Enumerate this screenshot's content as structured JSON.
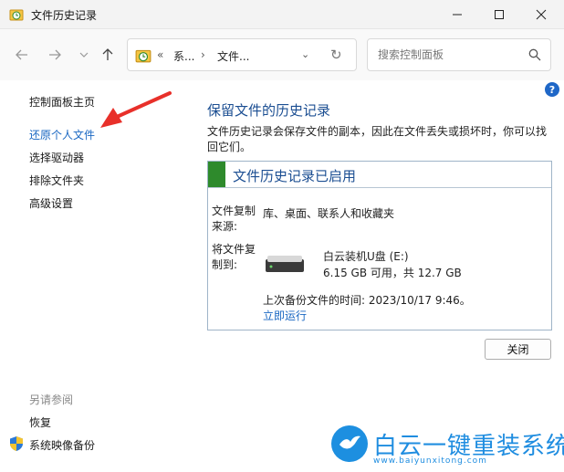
{
  "window": {
    "title": "文件历史记录"
  },
  "address": {
    "crumb1": "系...",
    "crumb2": "文件...",
    "prefix": "«"
  },
  "search": {
    "placeholder": "搜索控制面板"
  },
  "sidebar": {
    "items": [
      {
        "label": "控制面板主页"
      },
      {
        "label": "还原个人文件"
      },
      {
        "label": "选择驱动器"
      },
      {
        "label": "排除文件夹"
      },
      {
        "label": "高级设置"
      }
    ],
    "see_also_title": "另请参阅",
    "see_also": [
      {
        "label": "恢复"
      },
      {
        "label": "系统映像备份"
      }
    ]
  },
  "main": {
    "heading": "保留文件的历史记录",
    "description": "文件历史记录会保存文件的副本，因此在文件丢失或损坏时，你可以找回它们。",
    "status_title": "文件历史记录已启用",
    "copy_from_label": "文件复制来源:",
    "copy_from_value": "库、桌面、联系人和收藏夹",
    "copy_to_label": "将文件复制到:",
    "drive_name": "白云装机U盘 (E:)",
    "drive_space": "6.15 GB 可用，共 12.7 GB",
    "last_backup": "上次备份文件的时间: 2023/10/17 9:46。",
    "run_now": "立即运行",
    "close_button": "关闭"
  },
  "watermark": {
    "text": "白云一键重装系统",
    "url": "www.baiyunxitong.com"
  },
  "colors": {
    "accent": "#1967c2",
    "heading": "#1b4e92",
    "status_green": "#2e8a2c",
    "arrow_red": "#e8302a"
  }
}
